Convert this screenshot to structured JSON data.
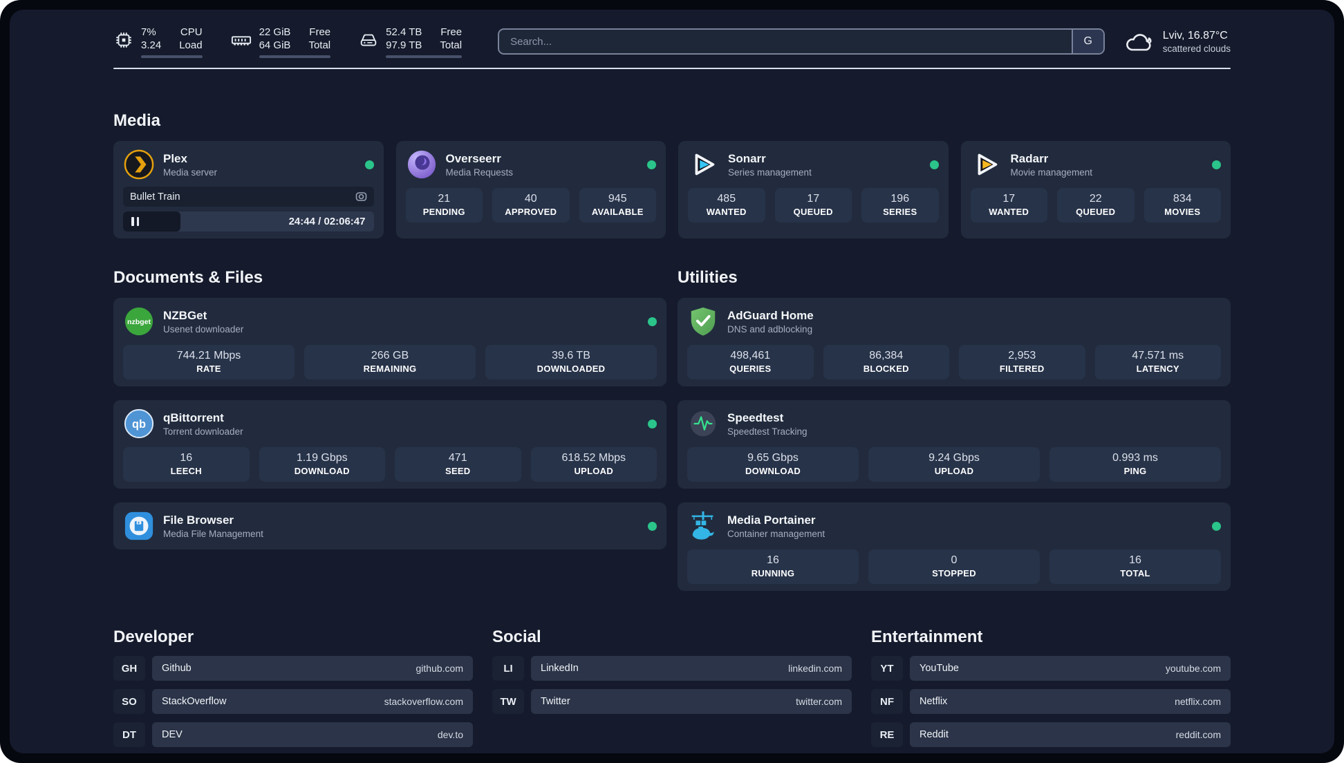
{
  "status_bar": {
    "cpu": {
      "value1": "7%",
      "value2": "3.24",
      "label1": "CPU",
      "label2": "Load",
      "progress": 8
    },
    "memory": {
      "value1": "22 GiB",
      "value2": "64 GiB",
      "label1": "Free",
      "label2": "Total",
      "progress": 65
    },
    "disk": {
      "value1": "52.4 TB",
      "value2": "97.9 TB",
      "label1": "Free",
      "label2": "Total",
      "progress": 46
    }
  },
  "search": {
    "placeholder": "Search...",
    "provider_button": "G"
  },
  "weather": {
    "location": "Lviv, 16.87°C",
    "condition": "scattered clouds"
  },
  "media": {
    "title": "Media",
    "plex": {
      "name": "Plex",
      "subtitle": "Media server",
      "now_playing": "Bullet Train",
      "elapsed": "24:44",
      "duration": "02:06:47",
      "time": "24:44 / 02:06:47",
      "progress": 23
    },
    "overseerr": {
      "name": "Overseerr",
      "subtitle": "Media Requests",
      "stats": [
        {
          "value": "21",
          "label": "PENDING"
        },
        {
          "value": "40",
          "label": "APPROVED"
        },
        {
          "value": "945",
          "label": "AVAILABLE"
        }
      ]
    },
    "sonarr": {
      "name": "Sonarr",
      "subtitle": "Series management",
      "stats": [
        {
          "value": "485",
          "label": "WANTED"
        },
        {
          "value": "17",
          "label": "QUEUED"
        },
        {
          "value": "196",
          "label": "SERIES"
        }
      ]
    },
    "radarr": {
      "name": "Radarr",
      "subtitle": "Movie management",
      "stats": [
        {
          "value": "17",
          "label": "WANTED"
        },
        {
          "value": "22",
          "label": "QUEUED"
        },
        {
          "value": "834",
          "label": "MOVIES"
        }
      ]
    }
  },
  "documents": {
    "title": "Documents & Files",
    "nzbget": {
      "name": "NZBGet",
      "subtitle": "Usenet downloader",
      "stats": [
        {
          "value": "744.21 Mbps",
          "label": "RATE"
        },
        {
          "value": "266 GB",
          "label": "REMAINING"
        },
        {
          "value": "39.6 TB",
          "label": "DOWNLOADED"
        }
      ]
    },
    "qbittorrent": {
      "name": "qBittorrent",
      "subtitle": "Torrent downloader",
      "stats": [
        {
          "value": "16",
          "label": "LEECH"
        },
        {
          "value": "1.19 Gbps",
          "label": "DOWNLOAD"
        },
        {
          "value": "471",
          "label": "SEED"
        },
        {
          "value": "618.52 Mbps",
          "label": "UPLOAD"
        }
      ]
    },
    "filebrowser": {
      "name": "File Browser",
      "subtitle": "Media File Management"
    }
  },
  "utilities": {
    "title": "Utilities",
    "adguard": {
      "name": "AdGuard Home",
      "subtitle": "DNS and adblocking",
      "stats": [
        {
          "value": "498,461",
          "label": "QUERIES"
        },
        {
          "value": "86,384",
          "label": "BLOCKED"
        },
        {
          "value": "2,953",
          "label": "FILTERED"
        },
        {
          "value": "47.571 ms",
          "label": "LATENCY"
        }
      ]
    },
    "speedtest": {
      "name": "Speedtest",
      "subtitle": "Speedtest Tracking",
      "stats": [
        {
          "value": "9.65 Gbps",
          "label": "DOWNLOAD"
        },
        {
          "value": "9.24 Gbps",
          "label": "UPLOAD"
        },
        {
          "value": "0.993 ms",
          "label": "PING"
        }
      ]
    },
    "portainer": {
      "name": "Media Portainer",
      "subtitle": "Container management",
      "stats": [
        {
          "value": "16",
          "label": "RUNNING"
        },
        {
          "value": "0",
          "label": "STOPPED"
        },
        {
          "value": "16",
          "label": "TOTAL"
        }
      ]
    }
  },
  "links": {
    "developer": {
      "title": "Developer",
      "items": [
        {
          "abbr": "GH",
          "name": "Github",
          "url": "github.com"
        },
        {
          "abbr": "SO",
          "name": "StackOverflow",
          "url": "stackoverflow.com"
        },
        {
          "abbr": "DT",
          "name": "DEV",
          "url": "dev.to"
        }
      ]
    },
    "social": {
      "title": "Social",
      "items": [
        {
          "abbr": "LI",
          "name": "LinkedIn",
          "url": "linkedin.com"
        },
        {
          "abbr": "TW",
          "name": "Twitter",
          "url": "twitter.com"
        }
      ]
    },
    "entertainment": {
      "title": "Entertainment",
      "items": [
        {
          "abbr": "YT",
          "name": "YouTube",
          "url": "youtube.com"
        },
        {
          "abbr": "NF",
          "name": "Netflix",
          "url": "netflix.com"
        },
        {
          "abbr": "RE",
          "name": "Reddit",
          "url": "reddit.com"
        }
      ]
    }
  },
  "colors": {
    "status_green": "#2bc48a",
    "page_bg": "#151b2c",
    "card_bg": "#212b3d"
  }
}
